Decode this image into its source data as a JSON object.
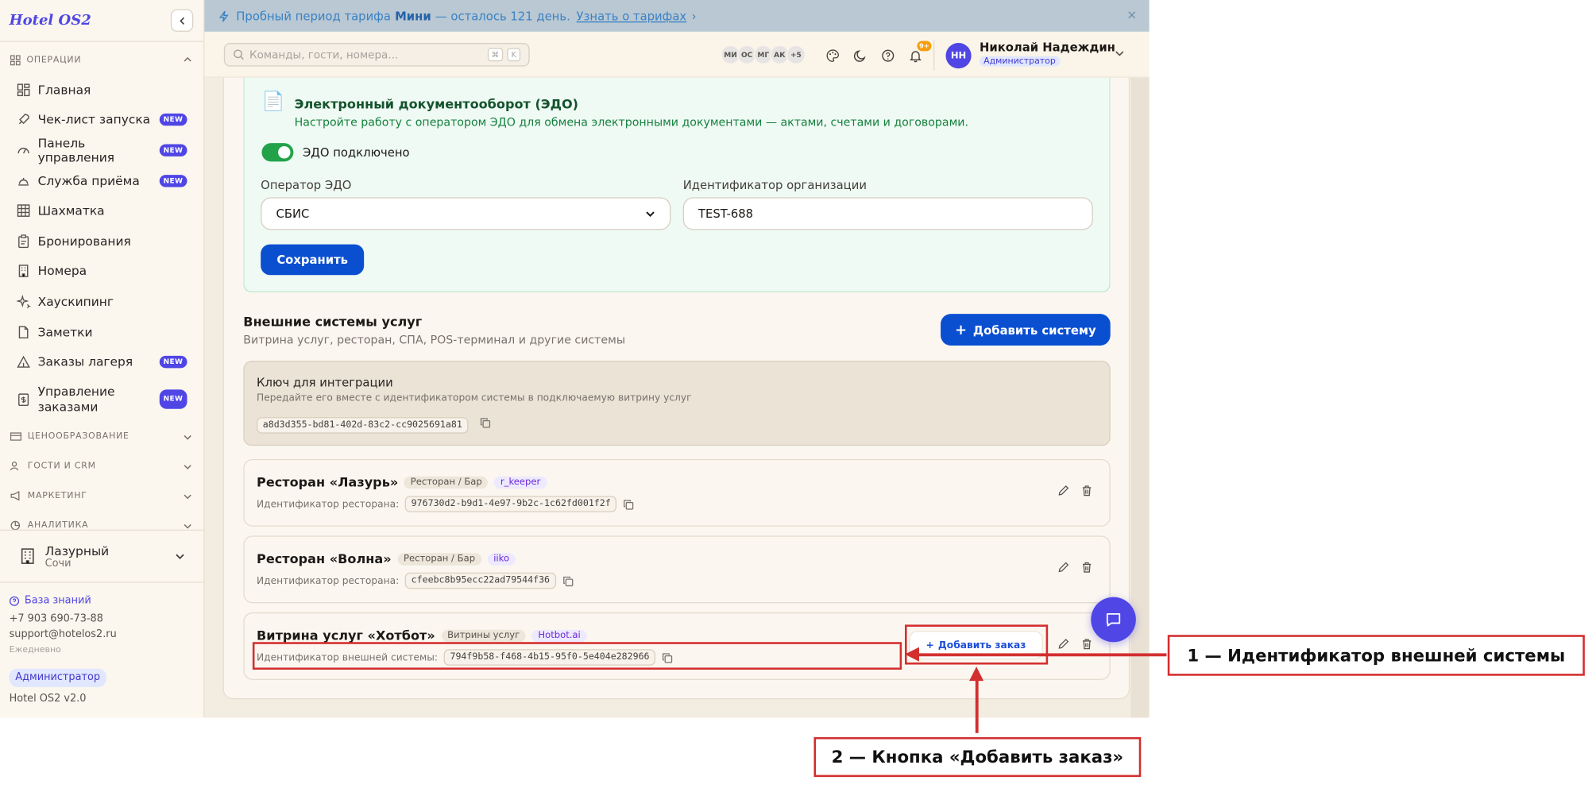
{
  "app": {
    "logo": "Hotel OS2"
  },
  "sidebar": {
    "sections": [
      {
        "label": "ОПЕРАЦИИ",
        "icon": "grid-icon"
      }
    ],
    "items": [
      {
        "label": "Главная",
        "icon": "dashboard-icon",
        "new": false
      },
      {
        "label": "Чек-лист запуска",
        "icon": "rocket-icon",
        "new": true
      },
      {
        "label": "Панель управления",
        "icon": "gauge-icon",
        "new": true
      },
      {
        "label": "Служба приёма",
        "icon": "bell-icon",
        "new": true
      },
      {
        "label": "Шахматка",
        "icon": "table-icon",
        "new": false
      },
      {
        "label": "Бронирования",
        "icon": "clipboard-icon",
        "new": false
      },
      {
        "label": "Номера",
        "icon": "building-icon",
        "new": false
      },
      {
        "label": "Хаускипинг",
        "icon": "sparkles-icon",
        "new": false
      },
      {
        "label": "Заметки",
        "icon": "note-icon",
        "new": false
      },
      {
        "label": "Заказы лагеря",
        "icon": "tent-icon",
        "new": true
      },
      {
        "label": "Управление заказами",
        "icon": "receipt-icon",
        "new": true
      }
    ],
    "collapsed_sections": [
      {
        "label": "ЦЕНООБРАЗОВАНИЕ",
        "icon": "card-icon"
      },
      {
        "label": "ГОСТИ И CRM",
        "icon": "users-icon"
      },
      {
        "label": "МАРКЕТИНГ",
        "icon": "megaphone-icon"
      },
      {
        "label": "АНАЛИТИКА",
        "icon": "chart-icon"
      }
    ],
    "new_badge": "NEW",
    "property": {
      "name": "Лазурный",
      "city": "Сочи"
    },
    "footer": {
      "knowledge_base": "База знаний",
      "phone": "+7 903 690-73-88",
      "email": "support@hotelos2.ru",
      "since": "Ежедневно",
      "role": "Администратор",
      "version": "Hotel OS2 v2.0"
    }
  },
  "banner": {
    "text_before": "Пробный период тарифа",
    "plan": "Мини",
    "text_after": "— осталось 121 день.",
    "link": "Узнать о тарифах",
    "link_arrow": "›",
    "close": "✕"
  },
  "topbar": {
    "search_placeholder": "Команды, гости, номера...",
    "kbd": [
      "⌘",
      "K"
    ],
    "avatars": [
      "МИ",
      "ОС",
      "МГ",
      "АК",
      "+5"
    ],
    "notifications_badge": "9+",
    "user": {
      "initials": "НН",
      "name": "Николай Надеждин",
      "role": "Администратор"
    }
  },
  "edo": {
    "icon": "📄",
    "title": "Электронный документооборот (ЭДО)",
    "subtitle": "Настройте работу с оператором ЭДО для обмена электронными документами — актами, счетами и договорами.",
    "toggle_label": "ЭДО подключено",
    "operator_label": "Оператор ЭДО",
    "operator_value": "СБИС",
    "org_id_label": "Идентификатор организации",
    "org_id_value": "TEST-688",
    "save": "Сохранить"
  },
  "external": {
    "title": "Внешние системы услуг",
    "subtitle": "Витрина услуг, ресторан, СПА, POS-терминал и другие системы",
    "add_button": "Добавить систему",
    "key": {
      "title": "Ключ для интеграции",
      "subtitle": "Передайте его вместе с идентификатором системы в подключаемую витрину услуг",
      "value": "a8d3d355-bd81-402d-83c2-cc9025691a81"
    },
    "systems": [
      {
        "name": "Ресторан «Лазурь»",
        "type": "Ресторан / Бар",
        "integration": "r_keeper",
        "id_label": "Идентификатор ресторана:",
        "id": "976730d2-b9d1-4e97-9b2c-1c62fd001f2f"
      },
      {
        "name": "Ресторан «Волна»",
        "type": "Ресторан / Бар",
        "integration": "iiko",
        "id_label": "Идентификатор ресторана:",
        "id": "cfeebc8b95ecc22ad79544f36"
      },
      {
        "name": "Витрина услуг «Хотбот»",
        "type": "Витрины услуг",
        "integration": "Hotbot.ai",
        "id_label": "Идентификатор внешней системы:",
        "id": "794f9b58-f468-4b15-95f0-5e404e282966",
        "add_order": "Добавить заказ"
      }
    ]
  },
  "annotations": {
    "one": "1 — Идентификатор внешней системы",
    "two": "2 — Кнопка «Добавить заказ»"
  },
  "colors": {
    "accent": "#4f46e5",
    "primary_button": "#0b4fd1",
    "annotation": "#d32f2f",
    "edo_bg": "#effaf4"
  }
}
